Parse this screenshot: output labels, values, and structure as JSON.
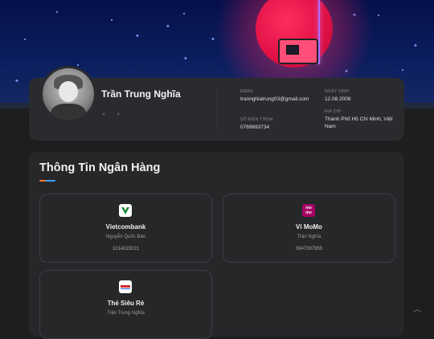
{
  "profile": {
    "name": "Trần Trung Nghĩa",
    "email_label": "EMAIL",
    "email": "trannghiatrung03@gmail.com",
    "dob_label": "NGÀY SINH",
    "dob": "12.08.2008",
    "phone_label": "SỐ ĐIỆN THOẠI",
    "phone": "0769693734",
    "address_label": "ĐỊA CHỈ",
    "address": "Thành Phố Hồ Chí Minh, Việt Nam"
  },
  "banks": {
    "title": "Thông Tin Ngân Hàng",
    "items": [
      {
        "name": "Vietcombank",
        "owner": "Nguyễn Quốc Bảo",
        "number": "1014315021",
        "logo_icon": "vietcombank-logo-icon",
        "logo_color": "#ffffff",
        "accent": "#1f8a3a"
      },
      {
        "name": "Ví MoMo",
        "owner": "Trần Nghĩa",
        "number": "0847397955",
        "logo_icon": "momo-logo-icon",
        "logo_color": "#a50064",
        "logo_text": "mo mo"
      },
      {
        "name": "Thẻ Siêu Rẻ",
        "owner": "Trần Trung Nghĩa",
        "number": "",
        "logo_icon": "thesieure-logo-icon",
        "logo_color": "#ffffff",
        "accent": "#d42a2a"
      }
    ]
  },
  "colors": {
    "page_bg": "#1e1e1e",
    "card_bg": "#2a2b2e",
    "hero_sky": "#06104a",
    "moon": "#e01045"
  },
  "icons": {
    "scroll_top": "chevron-up-icon"
  }
}
